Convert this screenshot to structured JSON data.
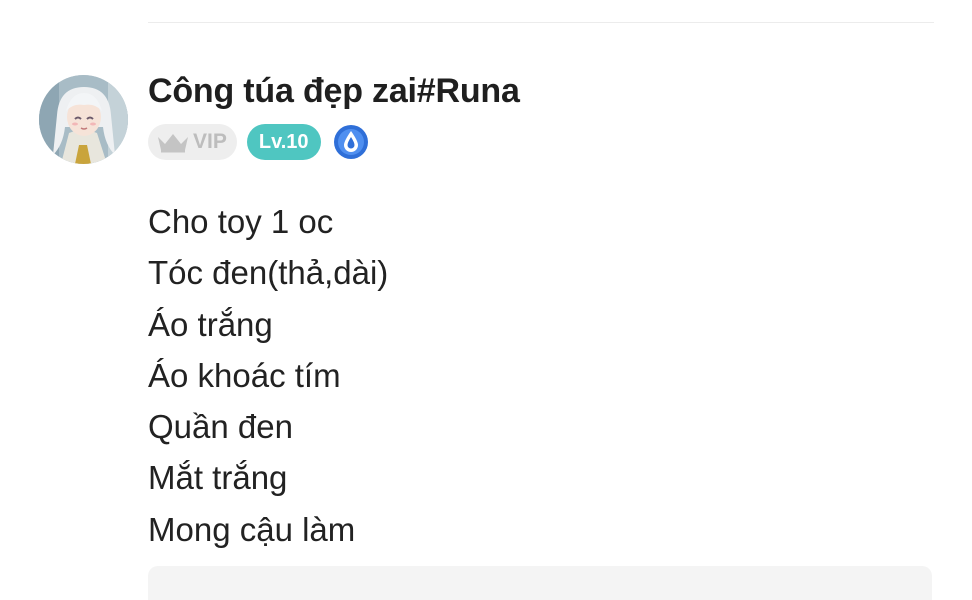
{
  "post": {
    "author": "Công túa đẹp zai#Runa",
    "badges": {
      "vip_label": "VIP",
      "level_label": "Lv.10",
      "vip_icon": "crown-icon",
      "extra_icon": "water-drop-icon"
    },
    "content_lines": [
      "Cho toy 1 oc",
      "Tóc đen(thả,dài)",
      "Áo trắng",
      "Áo khoác tím",
      "Quần đen",
      "Mắt trắng",
      "Mong cậu làm"
    ]
  },
  "colors": {
    "level_badge": "#4fc6c1",
    "vip_badge_bg": "#eeeeee",
    "vip_text": "#bdbdbd",
    "drop_badge": "#2f6fd8"
  }
}
